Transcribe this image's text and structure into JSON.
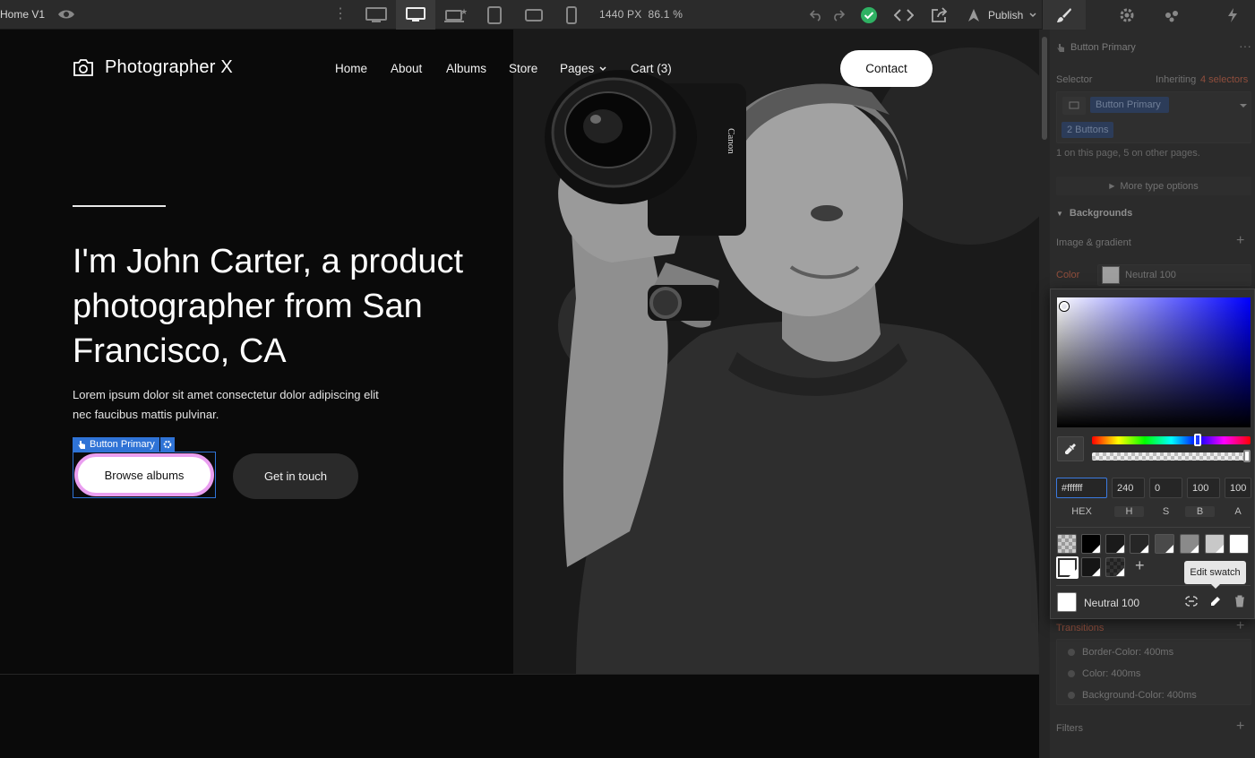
{
  "toolbar": {
    "page_name": "Home V1",
    "canvas_width": "1440 PX",
    "zoom": "86.1 %",
    "publish_label": "Publish",
    "breakpoints": [
      "desktop-large",
      "desktop",
      "laptop-star",
      "tablet",
      "mobile-landscape",
      "mobile-portrait"
    ]
  },
  "site": {
    "logo_text": "Photographer X",
    "nav": [
      "Home",
      "About",
      "Albums",
      "Store",
      "Pages",
      "Cart (3)"
    ],
    "contact_label": "Contact",
    "headline": "I'm John Carter, a product photographer from San Francisco, CA",
    "lead": "Lorem ipsum dolor sit amet consectetur dolor adipiscing elit nec faucibus mattis pulvinar.",
    "selected_badge": "Button Primary",
    "primary_button": "Browse albums",
    "secondary_button": "Get in touch"
  },
  "panel": {
    "element_name": "Button Primary",
    "selector_label": "Selector",
    "inheriting_label": "Inheriting",
    "inheriting_count": "4 selectors",
    "selector_tag": "Button Primary",
    "count_tag": "2 Buttons",
    "usage_note": "1 on this page, 5 on other pages.",
    "more_options": "More type options",
    "backgrounds_heading": "Backgrounds",
    "image_gradient": "Image & gradient",
    "color_label": "Color",
    "color_value": "Neutral 100",
    "transitions_heading": "Transitions",
    "transitions": [
      "Border-Color: 400ms",
      "Color: 400ms",
      "Background-Color: 400ms"
    ],
    "filters_heading": "Filters"
  },
  "picker": {
    "hex": "#ffffff",
    "h": "240",
    "s": "0",
    "b": "100",
    "a": "100",
    "labels": [
      "HEX",
      "H",
      "S",
      "B",
      "A"
    ],
    "swatch_name": "Neutral 100",
    "tooltip": "Edit swatch",
    "swatches_row1": [
      "transparent",
      "#000000",
      "#1a1a1a",
      "#262626",
      "#4a4a4a",
      "#8a8a8a",
      "#c8c8c8",
      "#ffffff"
    ],
    "swatches_row2": [
      "#ffffff",
      "#151515",
      "checker-dark"
    ]
  }
}
